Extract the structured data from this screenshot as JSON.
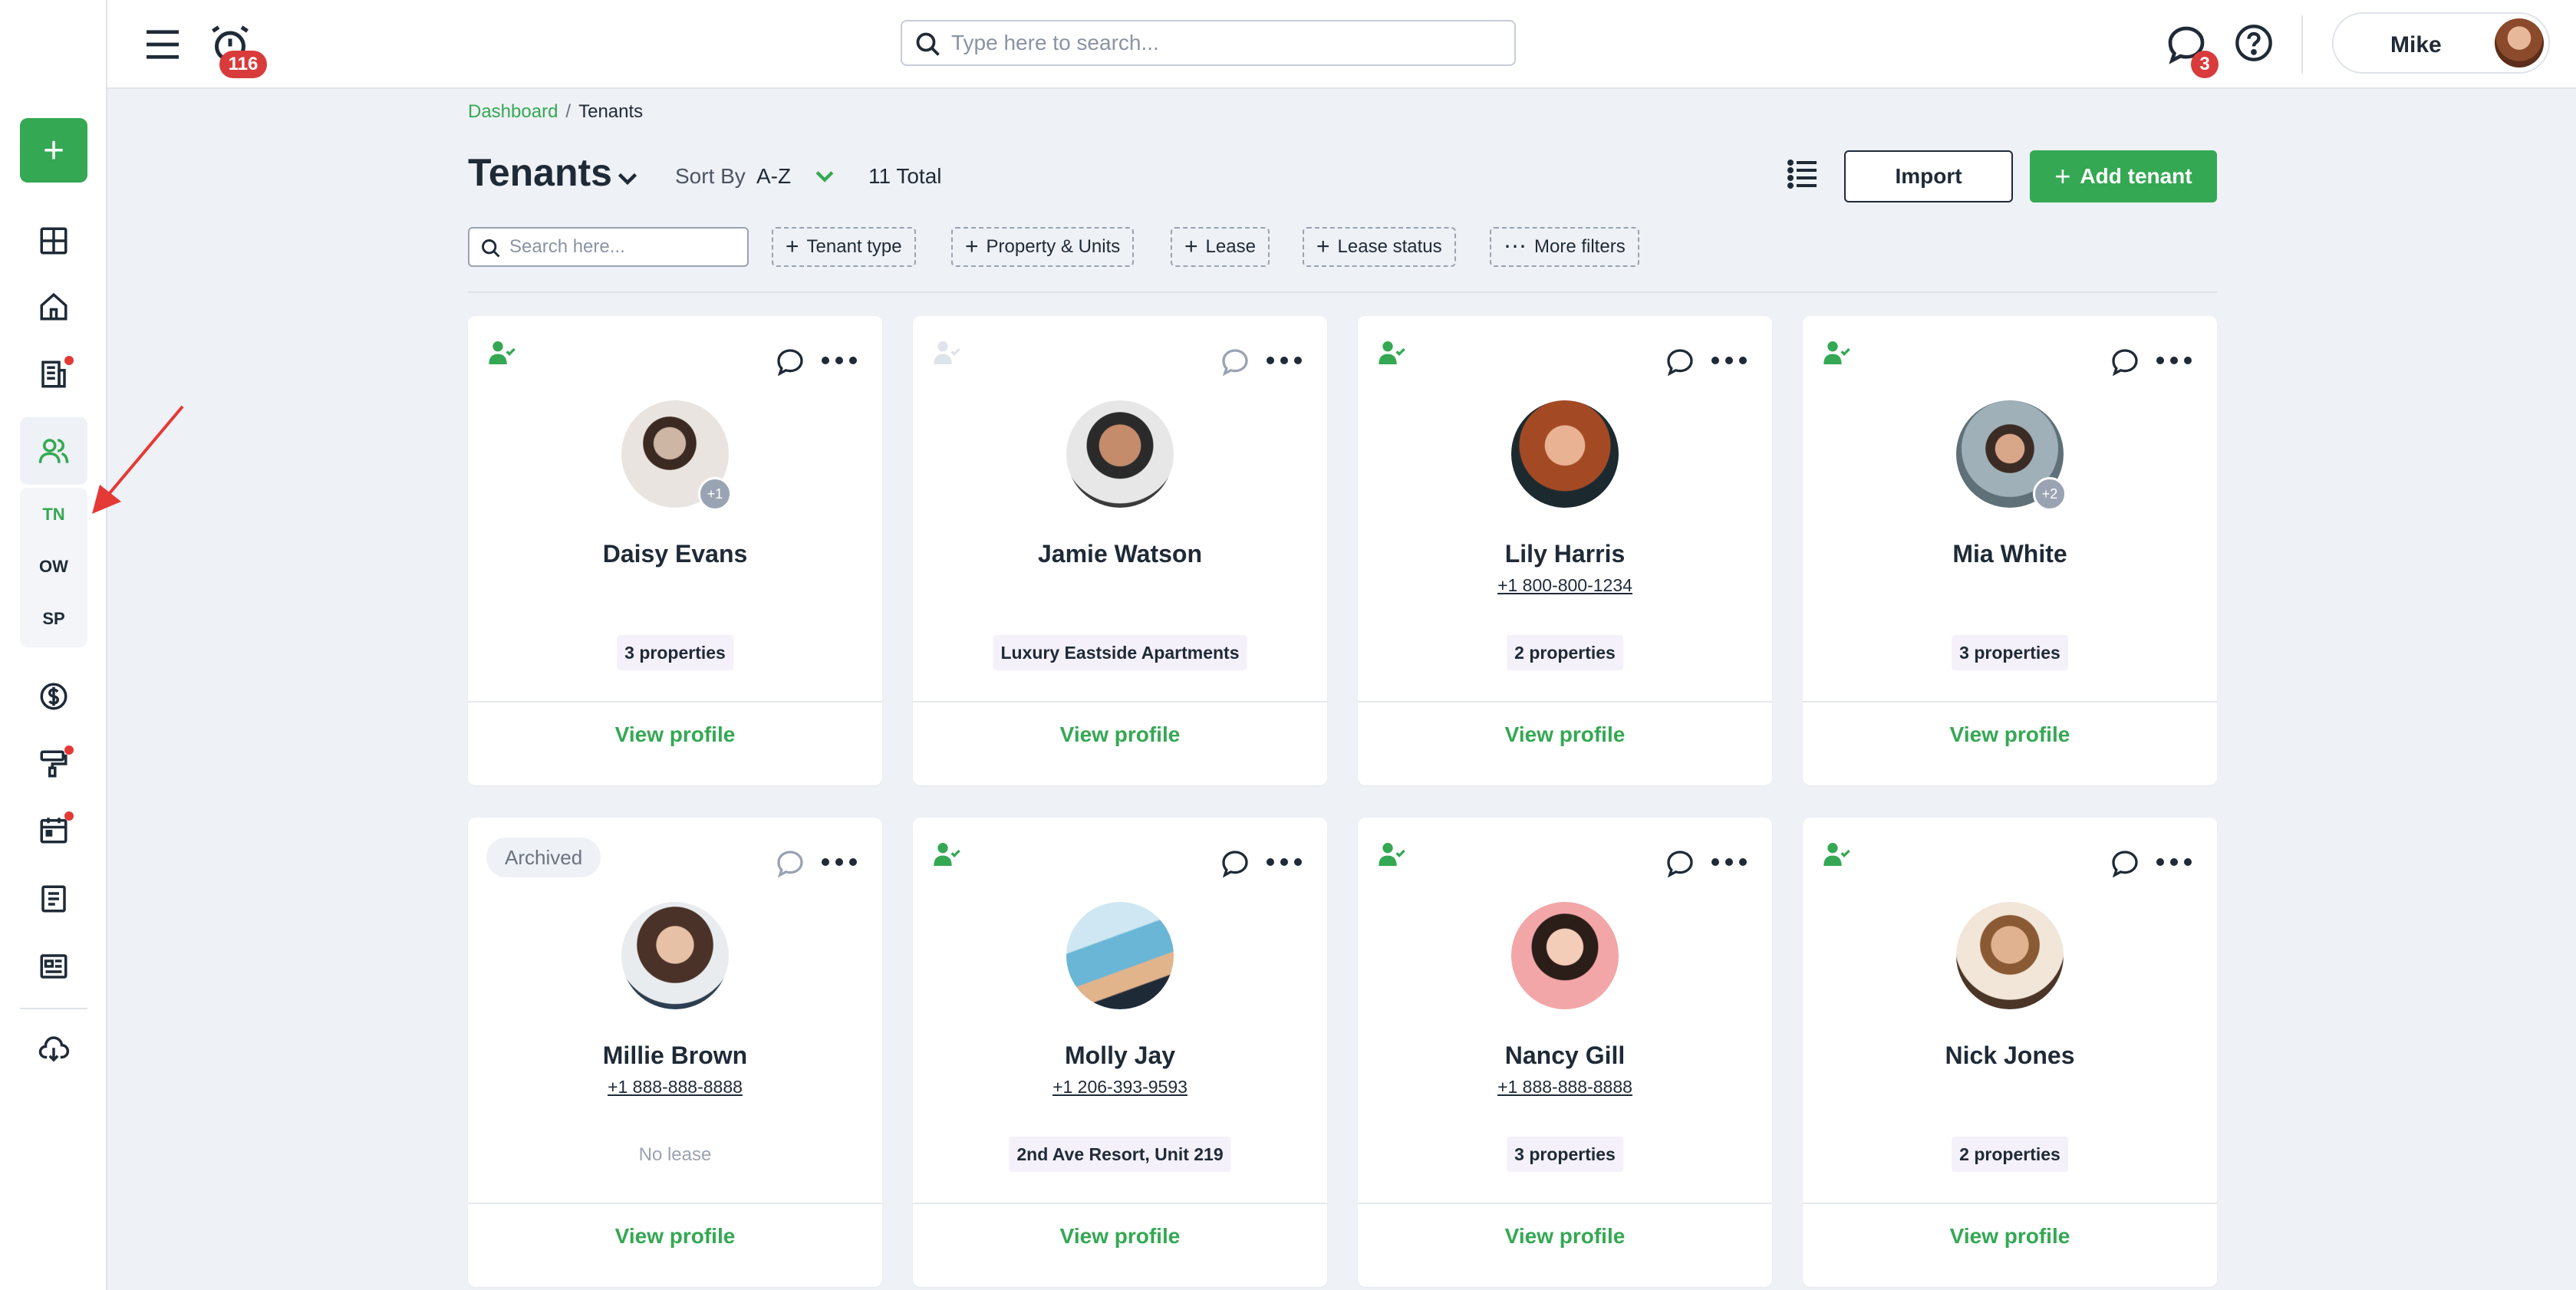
{
  "topbar": {
    "alarm_count": "116",
    "search_placeholder": "Type here to search...",
    "chat_count": "3",
    "user_name": "Mike"
  },
  "sidebar": {
    "add_label": "+",
    "sub_items": [
      "TN",
      "OW",
      "SP"
    ]
  },
  "breadcrumb": {
    "parent": "Dashboard",
    "separator": "/",
    "current": "Tenants"
  },
  "header": {
    "title": "Tenants",
    "sort_label": "Sort By",
    "sort_value": "A-Z",
    "total": "11 Total",
    "import_label": "Import",
    "add_label": "Add tenant",
    "add_plus": "+"
  },
  "filters": {
    "search_placeholder": "Search here...",
    "items": [
      "Tenant type",
      "Property & Units",
      "Lease",
      "Lease status",
      "More filters"
    ]
  },
  "cards": [
    {
      "name": "Daisy Evans",
      "phone": "",
      "tag": "3 properties",
      "badge": "+1",
      "view": "View profile",
      "archived": ""
    },
    {
      "name": "Jamie Watson",
      "phone": "",
      "tag": "Luxury Eastside Apartments",
      "badge": "",
      "view": "View profile",
      "archived": ""
    },
    {
      "name": "Lily Harris",
      "phone": "+1 800-800-1234",
      "tag": "2 properties",
      "badge": "",
      "view": "View profile",
      "archived": ""
    },
    {
      "name": "Mia White",
      "phone": "",
      "tag": "3 properties",
      "badge": "+2",
      "view": "View profile",
      "archived": ""
    },
    {
      "name": "Millie Brown",
      "phone": "+1 888-888-8888",
      "tag": "",
      "nolease": "No lease",
      "badge": "",
      "view": "View profile",
      "archived": "Archived"
    },
    {
      "name": "Molly Jay",
      "phone": "+1 206-393-9593",
      "tag": "2nd Ave Resort, Unit 219",
      "badge": "",
      "view": "View profile",
      "archived": ""
    },
    {
      "name": "Nancy Gill",
      "phone": "+1 888-888-8888",
      "tag": "3 properties",
      "badge": "",
      "view": "View profile",
      "archived": ""
    },
    {
      "name": "Nick Jones",
      "phone": "",
      "tag": "2 properties",
      "badge": "",
      "view": "View profile",
      "archived": ""
    }
  ],
  "colors": {
    "accent": "#34a853",
    "badge": "#d93b3b",
    "text": "#1f2a37"
  }
}
